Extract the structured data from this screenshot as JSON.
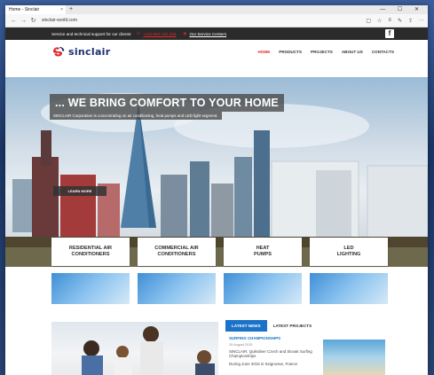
{
  "browser": {
    "tab_title": "Home - Sinclair",
    "tab_close": "×",
    "new_tab": "+",
    "url": "sinclair-world.com",
    "window_controls": "— ☐ ✕"
  },
  "topbar": {
    "support_text": "Service and technical support for our clients:",
    "phone_number": "+420 800 100 285",
    "service_centres": "Our Service Centers",
    "facebook_label": "f"
  },
  "header": {
    "logo_text": "sinclair",
    "nav": [
      "HOME",
      "PRODUCTS",
      "PROJECTS",
      "ABOUT US",
      "CONTACTS"
    ]
  },
  "hero": {
    "title": "... WE BRING COMFORT TO YOUR HOME",
    "subtitle": "SINCLAIR Corporation is concentrating on air conditioning, heat pumps and LED light segment.",
    "cta": "LEARN MORE"
  },
  "products": [
    {
      "line1": "RESIDENTIAL AIR",
      "line2": "CONDITIONERS"
    },
    {
      "line1": "COMMERCIAL AIR",
      "line2": "CONDITIONERS"
    },
    {
      "line1": "HEAT",
      "line2": "PUMPS"
    },
    {
      "line1": "LED",
      "line2": "LIGHTING"
    }
  ],
  "news": {
    "tabs": [
      "LATEST NEWS",
      "LATEST PROJECTS"
    ],
    "item_title": "SURFING CHAMPIONSHIPS",
    "item_date": "29 August 2015",
    "item_text": "SINCLAIR, Quiksilver Czech and Slovak Surfing Championships",
    "item_more": "During June 2015 in Seignosse, France"
  },
  "colors": {
    "accent_red": "#e2262a",
    "brand_navy": "#1c2f72",
    "tab_blue": "#1a73c9"
  }
}
